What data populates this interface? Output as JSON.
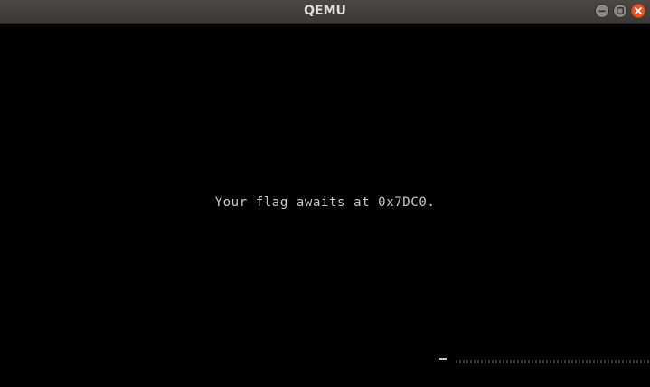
{
  "window": {
    "title": "QEMU",
    "controls": {
      "minimize_icon": "minimize-icon",
      "maximize_icon": "maximize-icon",
      "close_icon": "close-icon",
      "close_color": "#e95420"
    }
  },
  "screen": {
    "message": "Your flag awaits at 0x7DC0.",
    "background": "#000000",
    "text_color": "#c8c8c8"
  }
}
